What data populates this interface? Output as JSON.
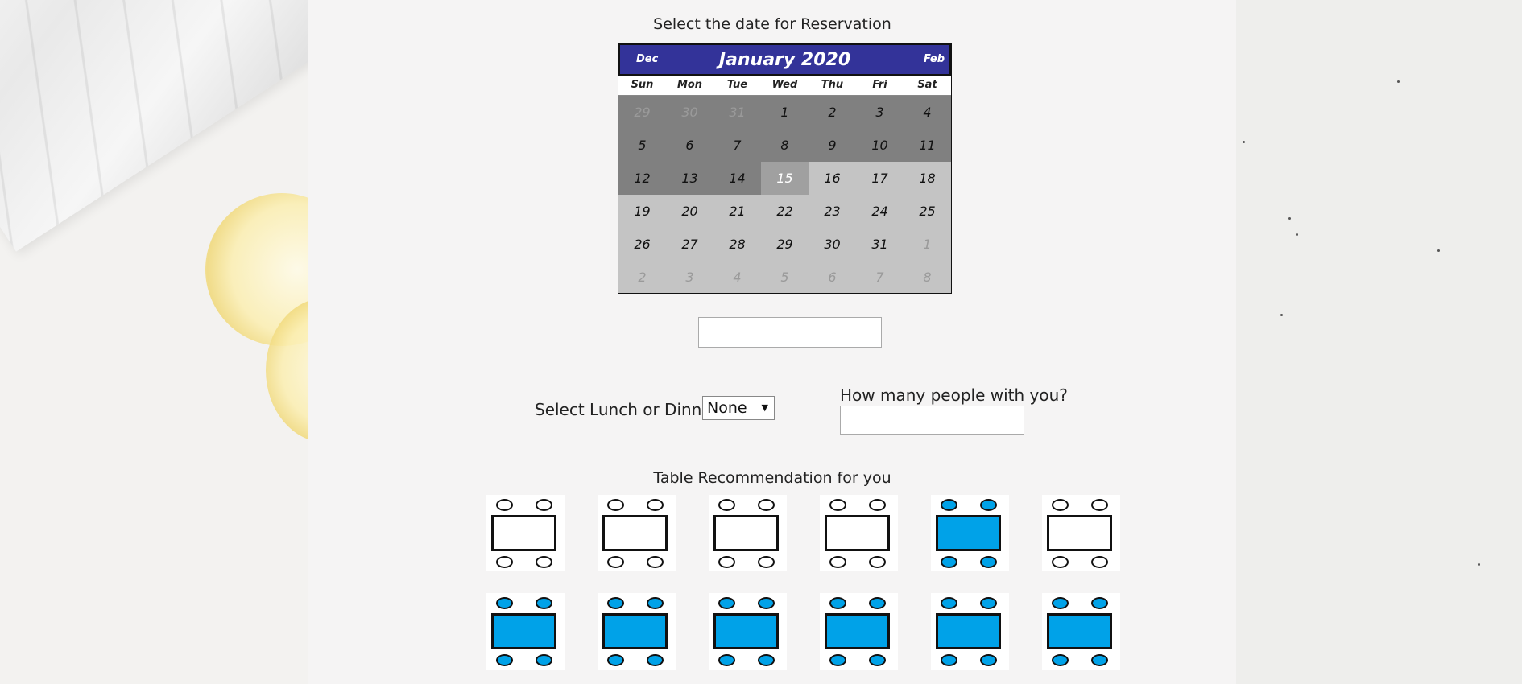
{
  "calendar": {
    "title": "Select the date for Reservation",
    "prev_label": "Dec",
    "next_label": "Feb",
    "month_label": "January 2020",
    "weekdays": [
      "Sun",
      "Mon",
      "Tue",
      "Wed",
      "Thu",
      "Fri",
      "Sat"
    ],
    "days": [
      {
        "d": "29",
        "state": "other-past"
      },
      {
        "d": "30",
        "state": "other-past"
      },
      {
        "d": "31",
        "state": "other-past"
      },
      {
        "d": "1",
        "state": "past"
      },
      {
        "d": "2",
        "state": "past"
      },
      {
        "d": "3",
        "state": "past"
      },
      {
        "d": "4",
        "state": "past"
      },
      {
        "d": "5",
        "state": "past"
      },
      {
        "d": "6",
        "state": "past"
      },
      {
        "d": "7",
        "state": "past"
      },
      {
        "d": "8",
        "state": "past"
      },
      {
        "d": "9",
        "state": "past"
      },
      {
        "d": "10",
        "state": "past"
      },
      {
        "d": "11",
        "state": "past"
      },
      {
        "d": "12",
        "state": "past"
      },
      {
        "d": "13",
        "state": "past"
      },
      {
        "d": "14",
        "state": "past"
      },
      {
        "d": "15",
        "state": "today"
      },
      {
        "d": "16",
        "state": "future"
      },
      {
        "d": "17",
        "state": "future"
      },
      {
        "d": "18",
        "state": "future"
      },
      {
        "d": "19",
        "state": "future"
      },
      {
        "d": "20",
        "state": "future"
      },
      {
        "d": "21",
        "state": "future"
      },
      {
        "d": "22",
        "state": "future"
      },
      {
        "d": "23",
        "state": "future"
      },
      {
        "d": "24",
        "state": "future"
      },
      {
        "d": "25",
        "state": "future"
      },
      {
        "d": "26",
        "state": "future"
      },
      {
        "d": "27",
        "state": "future"
      },
      {
        "d": "28",
        "state": "future"
      },
      {
        "d": "29",
        "state": "future"
      },
      {
        "d": "30",
        "state": "future"
      },
      {
        "d": "31",
        "state": "future"
      },
      {
        "d": "1",
        "state": "other"
      },
      {
        "d": "2",
        "state": "other"
      },
      {
        "d": "3",
        "state": "other"
      },
      {
        "d": "4",
        "state": "other"
      },
      {
        "d": "5",
        "state": "other"
      },
      {
        "d": "6",
        "state": "other"
      },
      {
        "d": "7",
        "state": "other"
      },
      {
        "d": "8",
        "state": "other"
      }
    ]
  },
  "date_field": {
    "value": "",
    "placeholder": ""
  },
  "meal": {
    "label": "Select Lunch or Dinner",
    "selected": "None"
  },
  "people": {
    "label": "How many people with you?",
    "value": ""
  },
  "recommendation": {
    "title": "Table Recommendation for you",
    "tables": [
      {
        "taken": false
      },
      {
        "taken": false
      },
      {
        "taken": false
      },
      {
        "taken": false
      },
      {
        "taken": true
      },
      {
        "taken": false
      },
      {
        "taken": true
      },
      {
        "taken": true
      },
      {
        "taken": true
      },
      {
        "taken": true
      },
      {
        "taken": true
      },
      {
        "taken": true
      }
    ]
  },
  "colors": {
    "calendar_header": "#333399",
    "taken_table": "#00a2e8"
  }
}
